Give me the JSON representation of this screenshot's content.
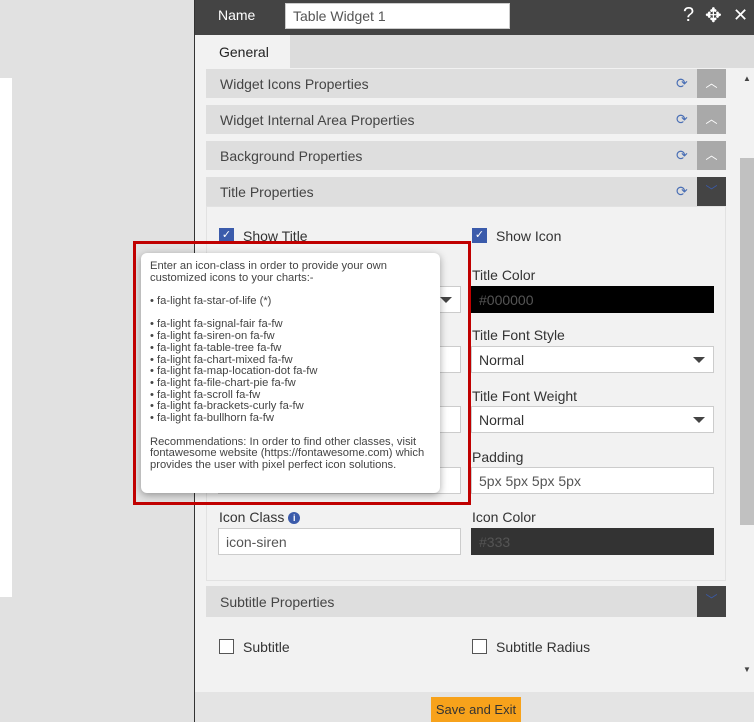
{
  "header": {
    "name_label": "Name",
    "name_value": "Table Widget 1",
    "icons": [
      "help-icon",
      "move-icon",
      "close-icon"
    ]
  },
  "tabs": [
    {
      "label": "General"
    }
  ],
  "sections": [
    {
      "title": "Widget Icons Properties",
      "state": "collapsed"
    },
    {
      "title": "Widget Internal Area Properties",
      "state": "collapsed"
    },
    {
      "title": "Background Properties",
      "state": "collapsed"
    },
    {
      "title": "Title Properties",
      "state": "expanded"
    }
  ],
  "title_props": {
    "show_title": {
      "label": "Show Title",
      "checked": true
    },
    "show_icon": {
      "label": "Show Icon",
      "checked": true
    },
    "title_color": {
      "label": "Title Color",
      "value": "#000000"
    },
    "title_font_style": {
      "label": "Title Font Style",
      "value": "Normal"
    },
    "title_font_weight": {
      "label": "Title Font Weight",
      "value": "Normal"
    },
    "padding": {
      "label": "Padding",
      "value": "5px 5px 5px 5px"
    },
    "icon_class": {
      "label": "Icon Class",
      "value": "icon-siren"
    },
    "icon_color": {
      "label": "Icon Color",
      "value": "#333"
    }
  },
  "subtitle": {
    "title": "Subtitle Properties",
    "subtitle": {
      "label": "Subtitle",
      "checked": false
    },
    "subtitle_radius": {
      "label": "Subtitle Radius",
      "checked": false
    }
  },
  "footer": {
    "save_label": "Save and Exit"
  },
  "tooltip": {
    "intro": "Enter an icon-class in order to provide your own customized icons to your charts:-",
    "star": "• fa-light fa-star-of-life (*)",
    "items": [
      "• fa-light fa-signal-fair fa-fw",
      "• fa-light fa-siren-on fa-fw",
      "• fa-light fa-table-tree fa-fw",
      "• fa-light fa-chart-mixed fa-fw",
      "• fa-light fa-map-location-dot fa-fw",
      "• fa-light fa-file-chart-pie fa-fw",
      "• fa-light fa-scroll fa-fw",
      "• fa-light fa-brackets-curly fa-fw",
      "• fa-light fa-bullhorn fa-fw"
    ],
    "recommendation": "Recommendations: In order to find other classes, visit fontawesome website (https://fontawesome.com) which provides the user with pixel perfect icon solutions."
  },
  "colors": {
    "accent": "#3b5bab",
    "save": "#f7a21b",
    "highlight": "#c00000"
  }
}
